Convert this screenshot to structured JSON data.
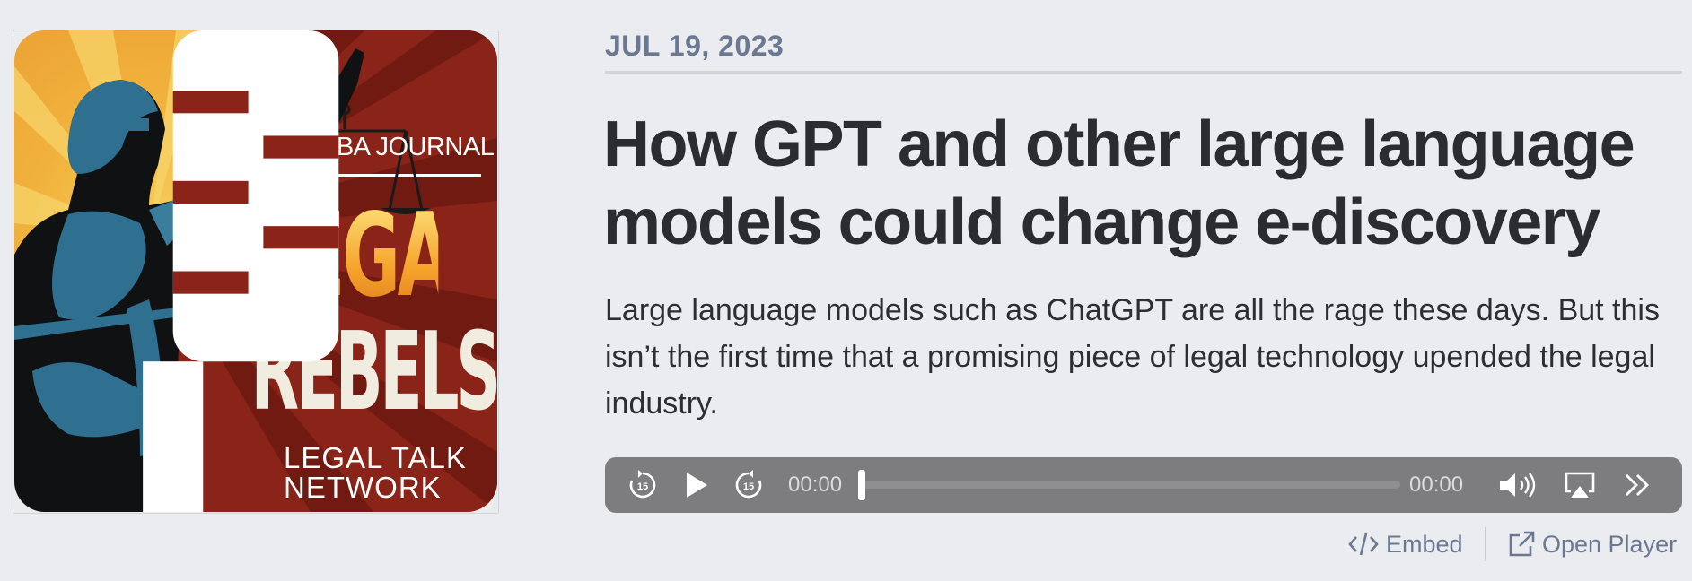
{
  "artwork": {
    "publisher": "ABA JOURNAL",
    "show_line1": "LEGAL",
    "show_line2": "REBELS",
    "network_line1": "LEGAL TALK",
    "network_line2": "NETWORK"
  },
  "episode": {
    "date": "JUL 19, 2023",
    "title": "How GPT and other large language models could change e-discovery",
    "description": "Large language models such as ChatGPT are all the rage these days. But this isn’t the first time that a promising piece of legal technology upended the legal industry."
  },
  "player": {
    "rewind_seconds": "15",
    "forward_seconds": "15",
    "current_time": "00:00",
    "duration": "00:00",
    "progress": 0
  },
  "links": {
    "embed": "Embed",
    "open_player": "Open Player"
  },
  "colors": {
    "background": "#ebecf0",
    "player_bar": "#7d7d80",
    "accent_text": "#6a7891",
    "title_text": "#2b2c30"
  },
  "icons": [
    "rewind-15-icon",
    "play-icon",
    "forward-15-icon",
    "volume-icon",
    "airplay-icon",
    "speed-chevrons-icon",
    "code-icon",
    "external-link-icon"
  ]
}
